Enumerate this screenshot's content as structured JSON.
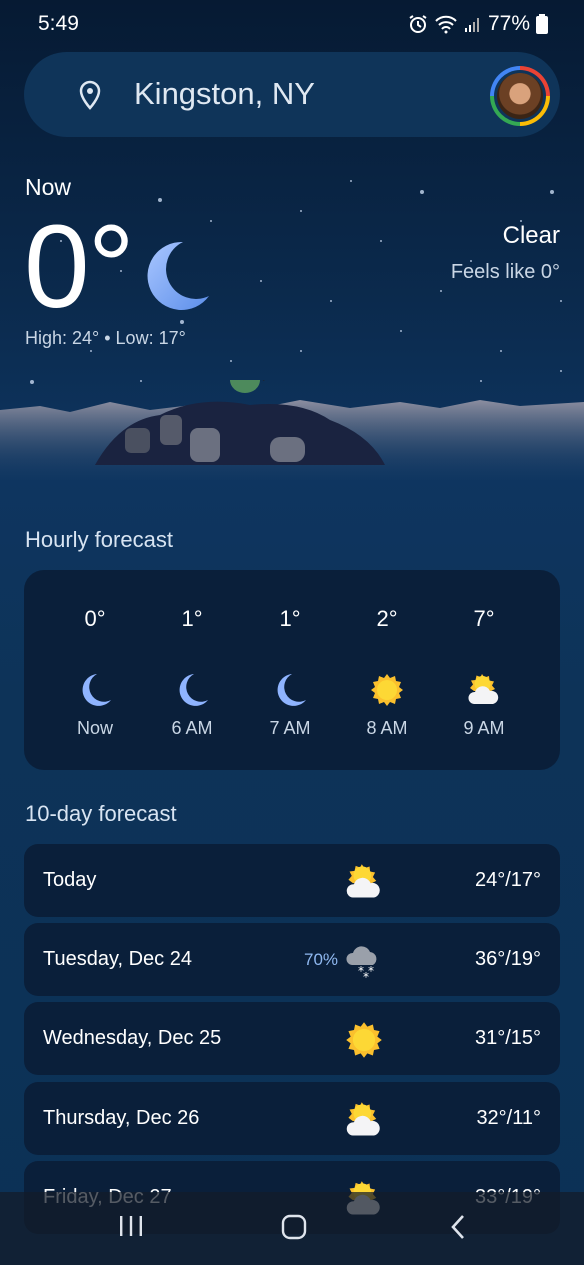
{
  "status": {
    "time": "5:49",
    "battery": "77%"
  },
  "search": {
    "location": "Kingston, NY"
  },
  "current": {
    "label": "Now",
    "temp": "0°",
    "high_low": "High: 24° • Low: 17°",
    "condition": "Clear",
    "feels_like": "Feels like 0°",
    "icon": "crescent-moon-icon"
  },
  "hourly": {
    "title": "Hourly forecast",
    "items": [
      {
        "temp": "0°",
        "time": "Now",
        "icon": "moon-icon"
      },
      {
        "temp": "1°",
        "time": "6 AM",
        "icon": "moon-icon"
      },
      {
        "temp": "1°",
        "time": "7 AM",
        "icon": "moon-icon"
      },
      {
        "temp": "2°",
        "time": "8 AM",
        "icon": "sun-icon"
      },
      {
        "temp": "7°",
        "time": "9 AM",
        "icon": "partly-cloudy-icon"
      }
    ]
  },
  "daily": {
    "title": "10-day forecast",
    "items": [
      {
        "day": "Today",
        "precip": "",
        "temps": "24°/17°",
        "icon": "partly-cloudy-icon"
      },
      {
        "day": "Tuesday, Dec 24",
        "precip": "70%",
        "temps": "36°/19°",
        "icon": "snow-cloud-icon"
      },
      {
        "day": "Wednesday, Dec 25",
        "precip": "",
        "temps": "31°/15°",
        "icon": "sun-icon"
      },
      {
        "day": "Thursday, Dec 26",
        "precip": "",
        "temps": "32°/11°",
        "icon": "partly-cloudy-icon"
      },
      {
        "day": "Friday, Dec 27",
        "precip": "",
        "temps": "33°/19°",
        "icon": "partly-cloudy-icon"
      }
    ]
  },
  "colors": {
    "accent_moon": "#8fb4ff",
    "sun": "#fbc02d",
    "card_bg": "#0a1f3a",
    "precip_text": "#8fb8f0"
  }
}
